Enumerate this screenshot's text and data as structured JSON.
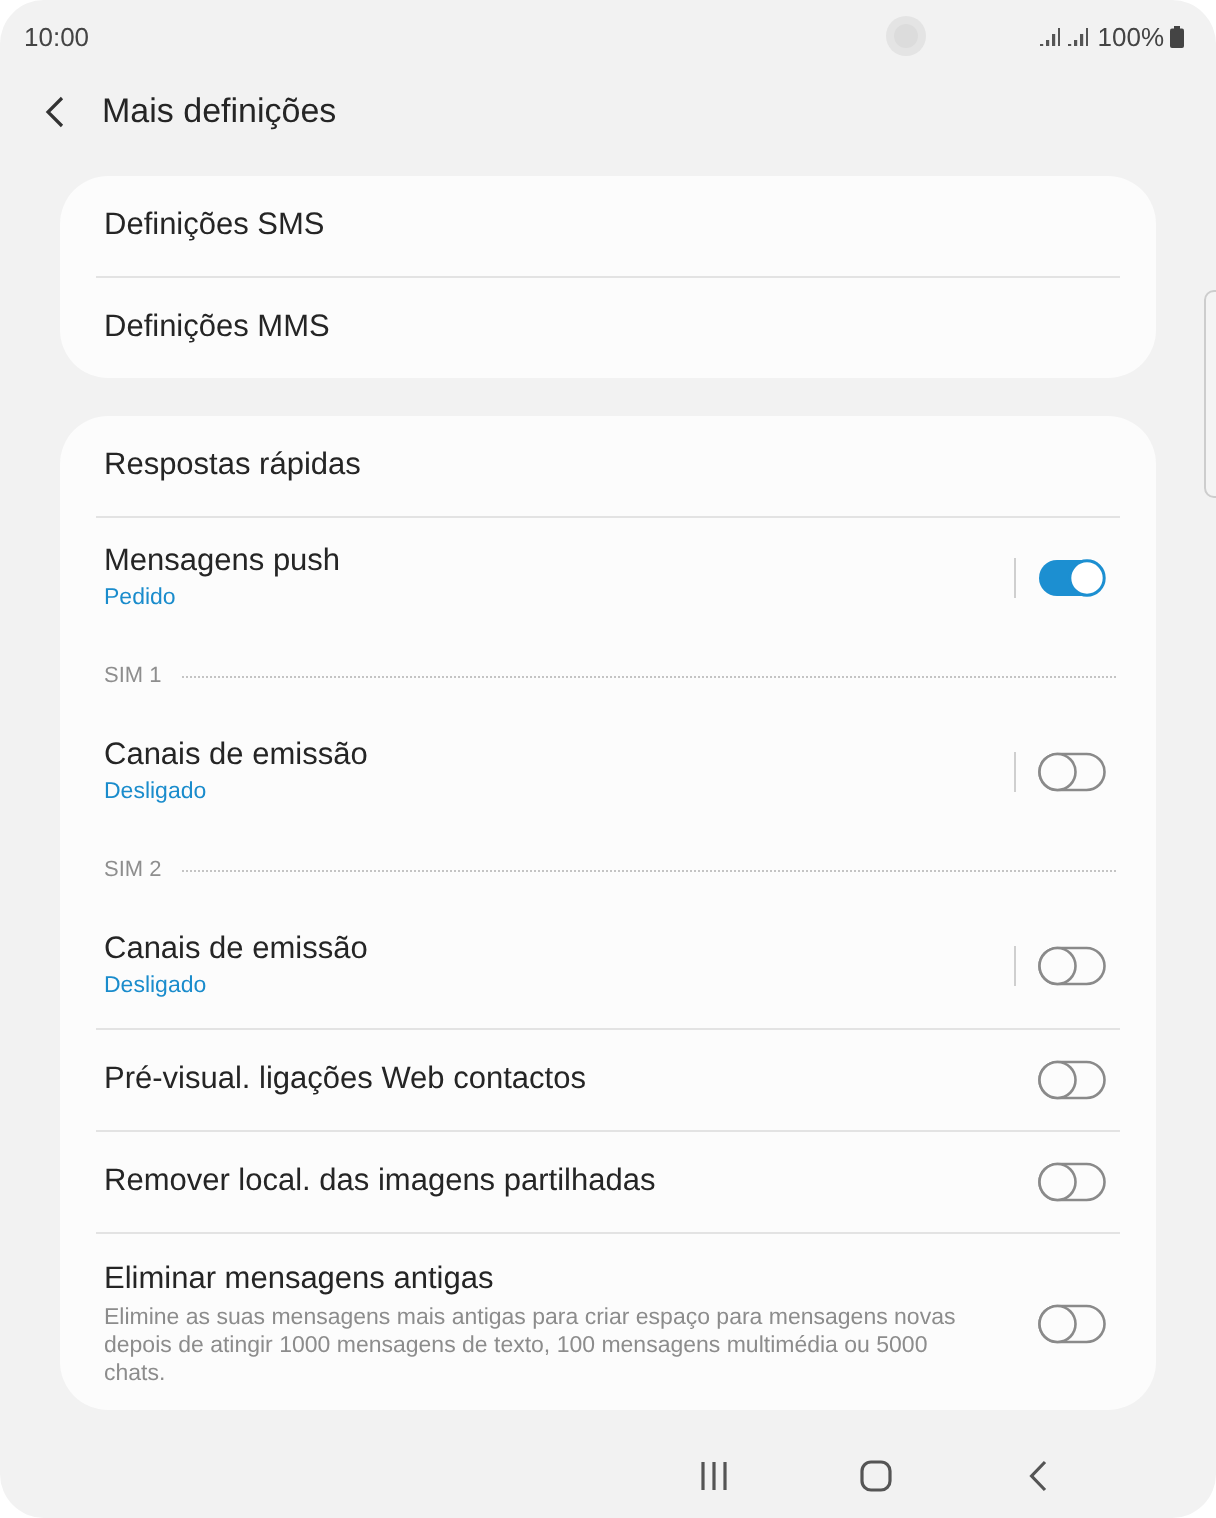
{
  "status_bar": {
    "time": "10:00",
    "battery": "100%"
  },
  "header": {
    "title": "Mais definições"
  },
  "groups": [
    {
      "items": [
        {
          "kind": "link",
          "title": "Definições SMS"
        },
        {
          "kind": "link",
          "title": "Definições MMS"
        }
      ]
    },
    {
      "items": [
        {
          "kind": "link",
          "title": "Respostas rápidas"
        },
        {
          "kind": "switch",
          "title": "Mensagens push",
          "summary": "Pedido",
          "on": true,
          "split": true
        },
        {
          "kind": "header",
          "title": "SIM 1"
        },
        {
          "kind": "switch",
          "title": "Canais de emissão",
          "summary": "Desligado",
          "on": false,
          "split": true
        },
        {
          "kind": "header",
          "title": "SIM 2"
        },
        {
          "kind": "switch",
          "title": "Canais de emissão",
          "summary": "Desligado",
          "on": false,
          "split": true
        },
        {
          "kind": "switch",
          "title": "Pré-visual. ligações Web contactos",
          "on": false,
          "split": false
        },
        {
          "kind": "switch",
          "title": "Remover local. das imagens partilhadas",
          "on": false,
          "split": false
        },
        {
          "kind": "switch",
          "title": "Eliminar mensagens antigas",
          "description": "Elimine as suas mensagens mais antigas para criar espaço para mensagens novas depois de atingir 1000 mensagens de texto, 100 mensagens multimédia ou 5000 chats.",
          "on": false,
          "split": false
        }
      ]
    }
  ]
}
